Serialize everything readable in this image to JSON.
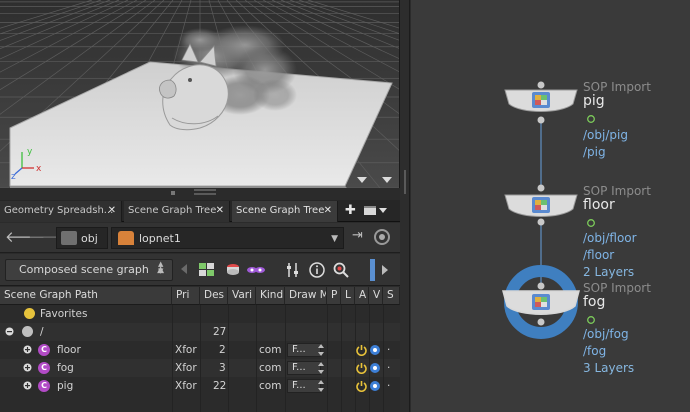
{
  "tabs": [
    {
      "label": "Geometry Spreadsh...",
      "close": "✕",
      "active": false
    },
    {
      "label": "Scene Graph Tree",
      "close": "✕",
      "active": false
    },
    {
      "label": "Scene Graph Tree",
      "close": "✕",
      "active": true
    }
  ],
  "path_bar": {
    "context": "obj",
    "network": "lopnet1"
  },
  "toolbar": {
    "mode_select": "Composed scene graph"
  },
  "table": {
    "columns": [
      "Scene Graph Path",
      "Pri",
      "Des",
      "Vari",
      "Kind",
      "Draw M",
      "P",
      "L",
      "A",
      "V",
      "S"
    ],
    "rows": [
      {
        "name": "Favorites",
        "pri": "",
        "des": "",
        "kind": "",
        "draw": ""
      },
      {
        "name": "/",
        "pri": "",
        "des": "27",
        "kind": "",
        "draw": ""
      },
      {
        "name": "floor",
        "pri": "Xfor",
        "des": "2",
        "kind": "com",
        "draw": "F..."
      },
      {
        "name": "fog",
        "pri": "Xfor",
        "des": "3",
        "kind": "com",
        "draw": "F..."
      },
      {
        "name": "pig",
        "pri": "Xfor",
        "des": "22",
        "kind": "com",
        "draw": "F..."
      }
    ],
    "prim_icon_letter": "C",
    "dot": "·"
  },
  "network": {
    "nodes": [
      {
        "type": "SOP Import",
        "name": "pig",
        "lines": [
          "/obj/pig",
          "/pig"
        ]
      },
      {
        "type": "SOP Import",
        "name": "floor",
        "lines": [
          "/obj/floor",
          "/floor",
          "2 Layers"
        ]
      },
      {
        "type": "SOP Import",
        "name": "fog",
        "lines": [
          "/obj/fog",
          "/fog",
          "3 Layers"
        ]
      }
    ],
    "selected_node": "fog",
    "colors": {
      "selection_ring": "#3f7fc0",
      "wire": "#5e8fc2",
      "info_text": "#7fb4e6"
    }
  },
  "viewport": {
    "axis_labels": [
      "y",
      "x",
      "z"
    ]
  },
  "icons": {
    "back": "left-arrow-icon",
    "forward": "right-arrow-icon",
    "pin": "pin-icon",
    "link": "link-icon",
    "add_tab": "plus-icon",
    "close_tab": "close-icon"
  }
}
